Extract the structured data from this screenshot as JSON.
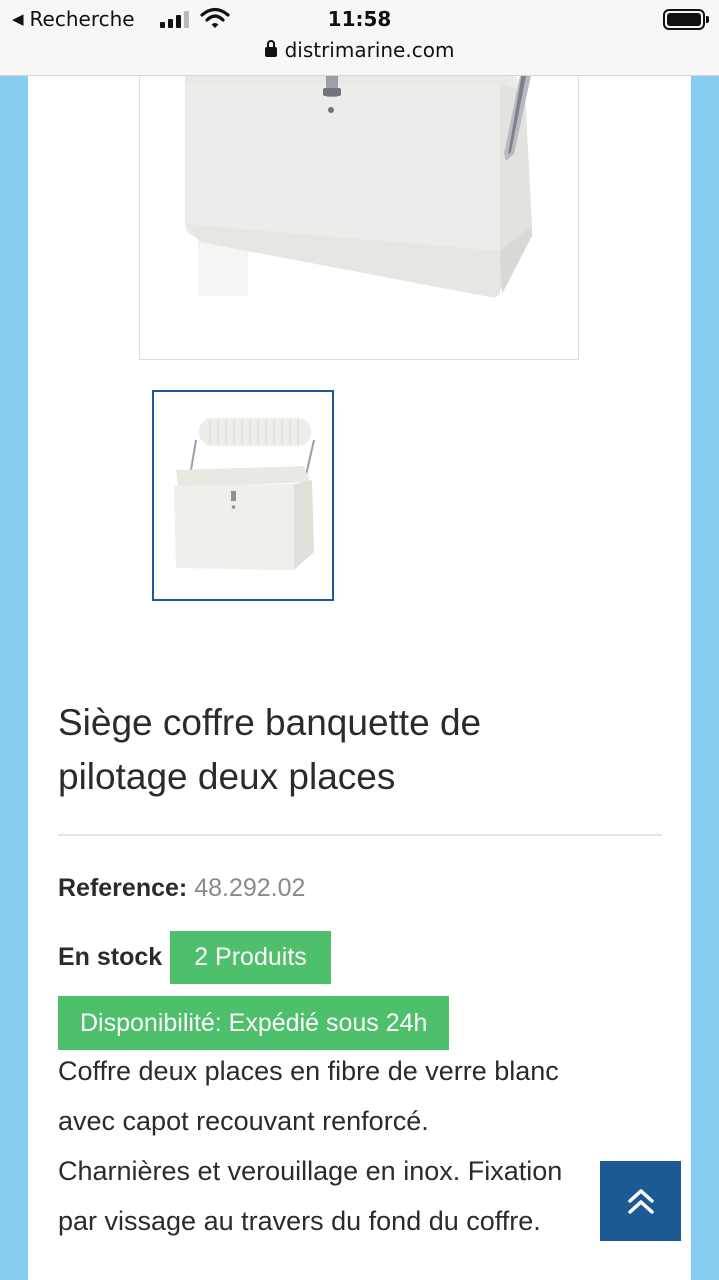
{
  "status_bar": {
    "back_label": "Recherche",
    "time": "11:58",
    "url": "distrimarine.com"
  },
  "product": {
    "title_line1": "Siège coffre banquette de",
    "title_line2": "pilotage deux places",
    "reference_label": "Reference:",
    "reference_value": "48.292.02",
    "stock_label": "En stock",
    "stock_badge": "2 Produits",
    "availability": "Disponibilité: Expédié sous 24h",
    "description_lines": [
      "Coffre deux places en fibre de verre blanc",
      "avec capot recouvant renforcé.",
      "Charnières et verouillage en inox. Fixation",
      "par vissage au travers du fond du coffre."
    ]
  },
  "colors": {
    "page_bg": "#87cdf0",
    "accent_blue": "#1d5a94",
    "stock_green": "#4ebf6a"
  },
  "icons": {
    "scroll_top": "double-chevron-up-icon",
    "lock": "lock-icon"
  }
}
